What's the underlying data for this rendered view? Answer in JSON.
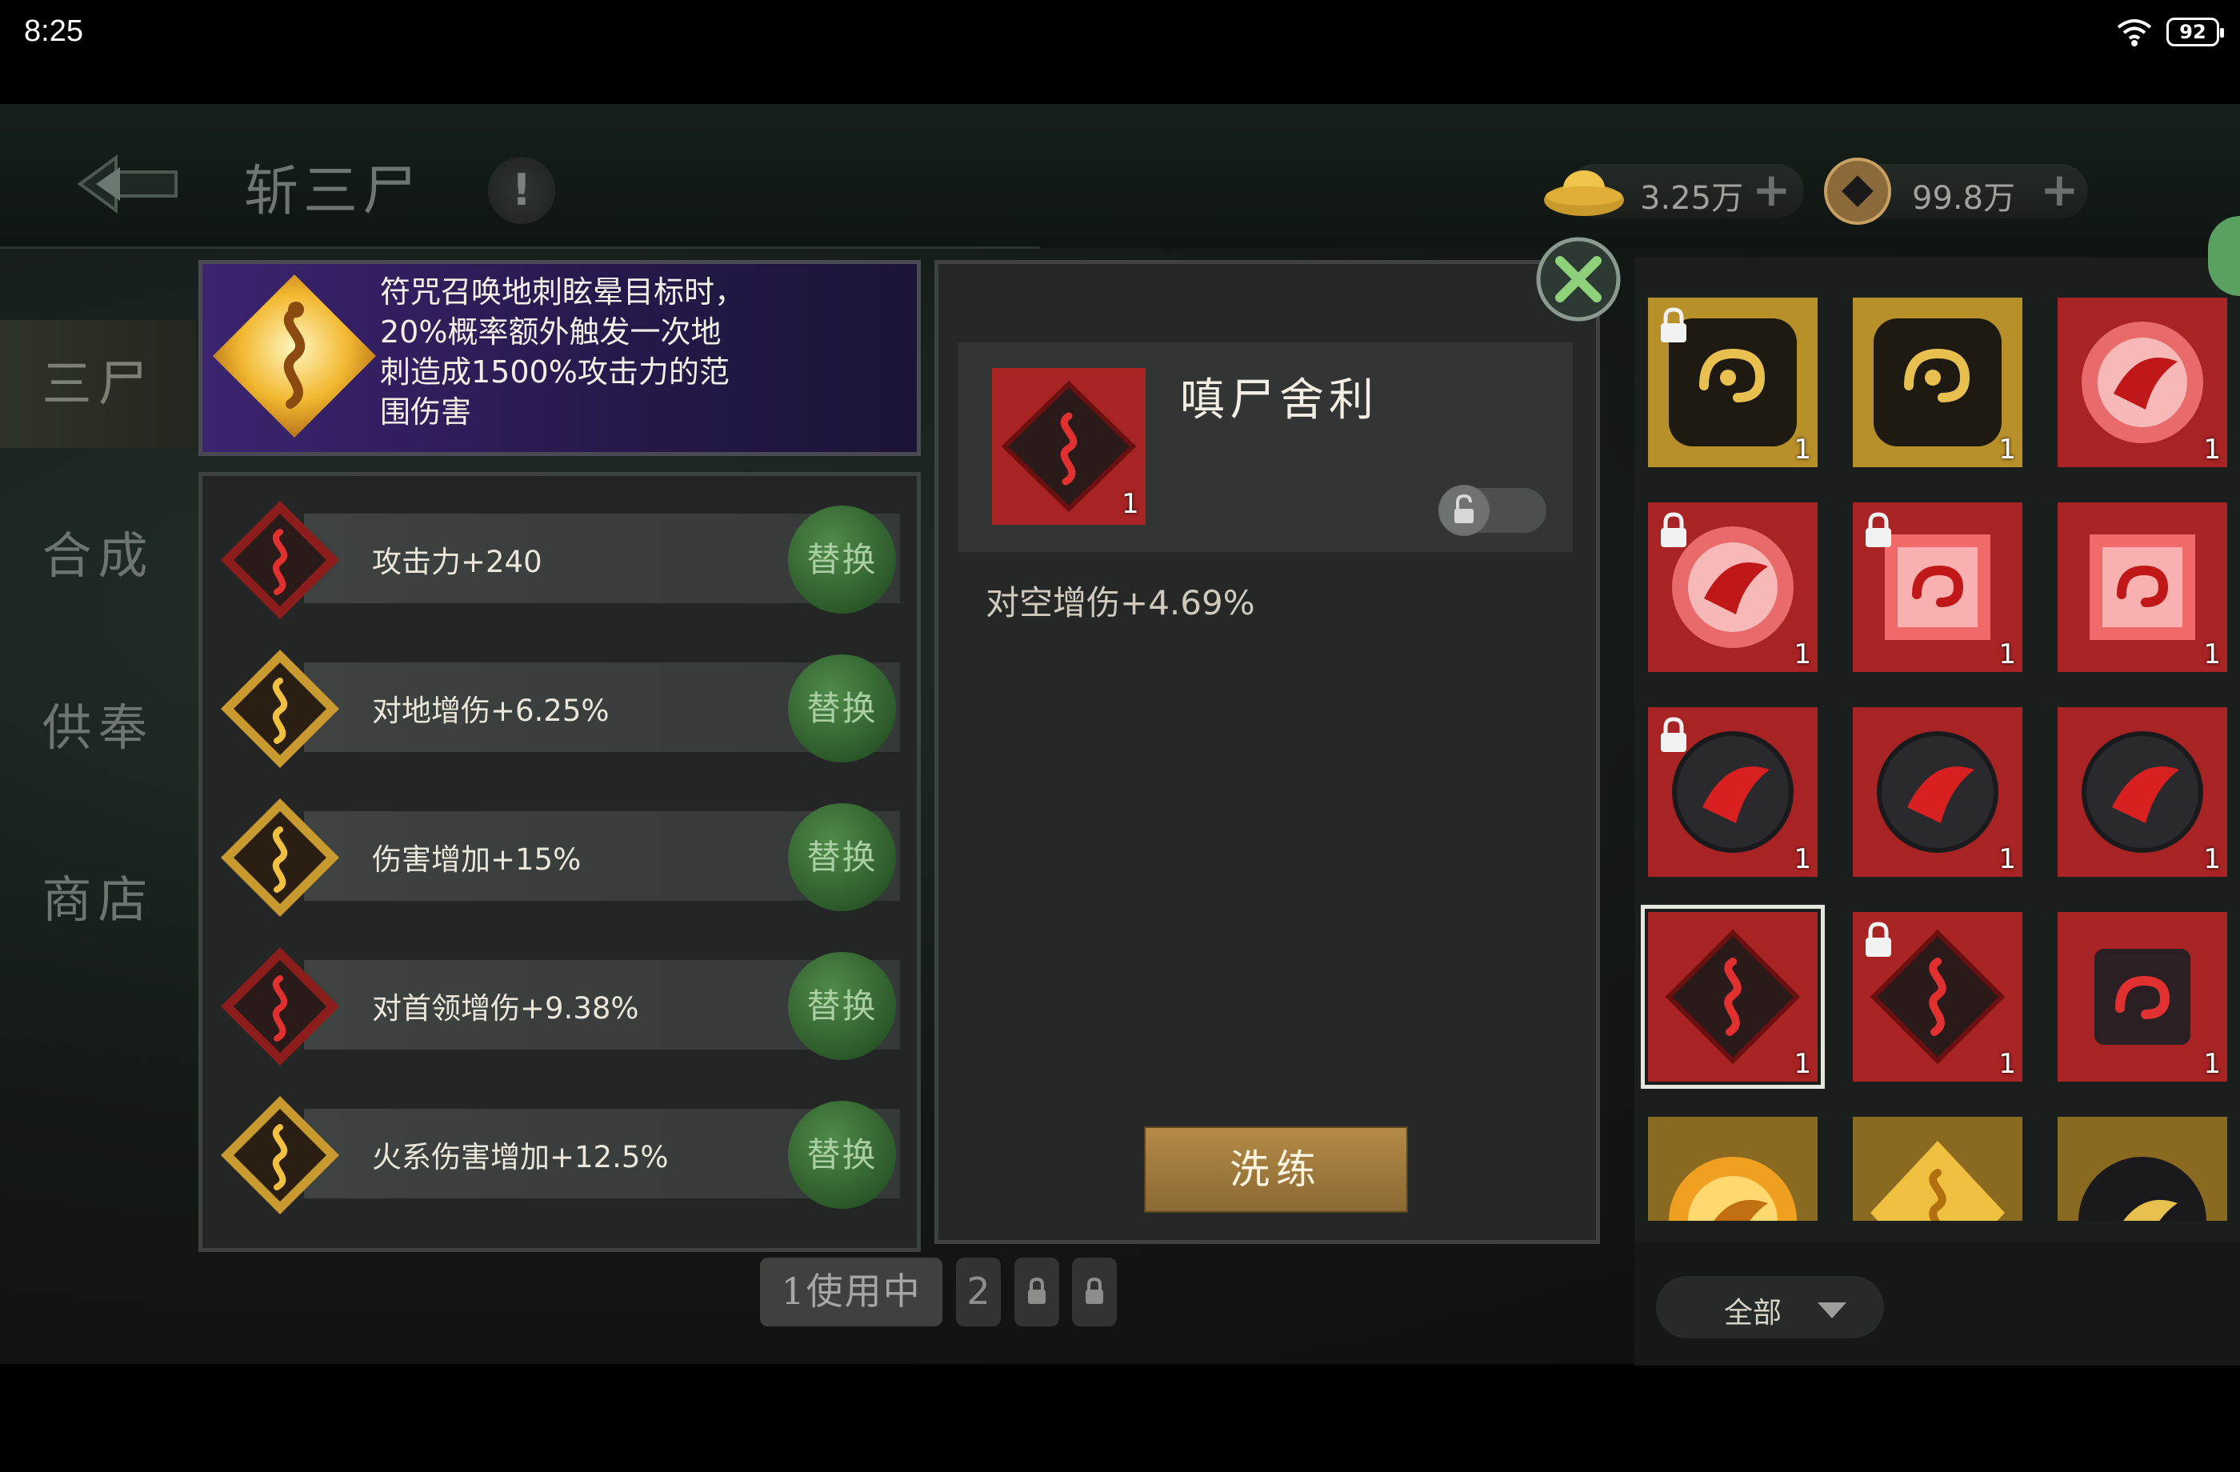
{
  "status_bar": {
    "time": "8:25",
    "battery": "92"
  },
  "header": {
    "title": "斩三尸",
    "help": "!"
  },
  "currency": [
    {
      "name": "gold-ingot",
      "value": "3.25万",
      "plus": "+"
    },
    {
      "name": "copper-coin",
      "value": "99.8万",
      "plus": "+"
    }
  ],
  "nav": [
    {
      "label": "三尸",
      "active": true
    },
    {
      "label": "合成"
    },
    {
      "label": "供奉"
    },
    {
      "label": "商店"
    }
  ],
  "description": "符咒召唤地刺眩晕目标时，20%概率额外触发一次地刺造成1500%攻击力的范围伤害",
  "attributes": [
    {
      "label": "攻击力+240",
      "icon": "red-snake-icon",
      "button": "替换"
    },
    {
      "label": "对地增伤+6.25%",
      "icon": "gold-snake-icon",
      "button": "替换"
    },
    {
      "label": "伤害增加+15%",
      "icon": "gold-snake-icon",
      "button": "替换"
    },
    {
      "label": "对首领增伤+9.38%",
      "icon": "red-snake-icon",
      "button": "替换"
    },
    {
      "label": "火系伤害增加+12.5%",
      "icon": "gold-snake-icon",
      "button": "替换"
    }
  ],
  "detail": {
    "name": "嗔尸舍利",
    "count": "1",
    "stat": "对空增伤+4.69%",
    "refine_button": "洗练"
  },
  "slots": [
    {
      "label": "1使用中",
      "active": true
    },
    {
      "label": "2"
    },
    {
      "label": "locked"
    },
    {
      "label": "locked"
    }
  ],
  "inventory": [
    {
      "icon": "gold-swirl-icon",
      "count": "1",
      "locked": true
    },
    {
      "icon": "gold-swirl-icon",
      "count": "1",
      "locked": false
    },
    {
      "icon": "red-phoenix-orb-icon",
      "count": "1",
      "locked": false
    },
    {
      "icon": "red-phoenix-orb-icon",
      "count": "1",
      "locked": true
    },
    {
      "icon": "red-swirl-gem-icon",
      "count": "1",
      "locked": true
    },
    {
      "icon": "red-swirl-gem-icon",
      "count": "1",
      "locked": false
    },
    {
      "icon": "dark-phoenix-orb-icon",
      "count": "1",
      "locked": true
    },
    {
      "icon": "dark-phoenix-orb-icon",
      "count": "1",
      "locked": false
    },
    {
      "icon": "dark-phoenix-orb-icon",
      "count": "1",
      "locked": false
    },
    {
      "icon": "red-snake-icon",
      "count": "1",
      "locked": false,
      "selected": true
    },
    {
      "icon": "red-snake-icon",
      "count": "1",
      "locked": true
    },
    {
      "icon": "dark-swirl-square-icon",
      "count": "1",
      "locked": false
    },
    {
      "icon": "gold-phoenix-orb-icon",
      "count": "",
      "locked": false
    },
    {
      "icon": "gold-snake-icon",
      "count": "",
      "locked": false
    },
    {
      "icon": "dark-gold-phoenix-orb-icon",
      "count": "",
      "locked": false
    }
  ],
  "filter": {
    "label": "全部"
  },
  "colors": {
    "accent_green": "#3f7a3a",
    "panel": "#252827",
    "desc_purple": "#3c2470",
    "refine_gold": "#a67f3f"
  }
}
